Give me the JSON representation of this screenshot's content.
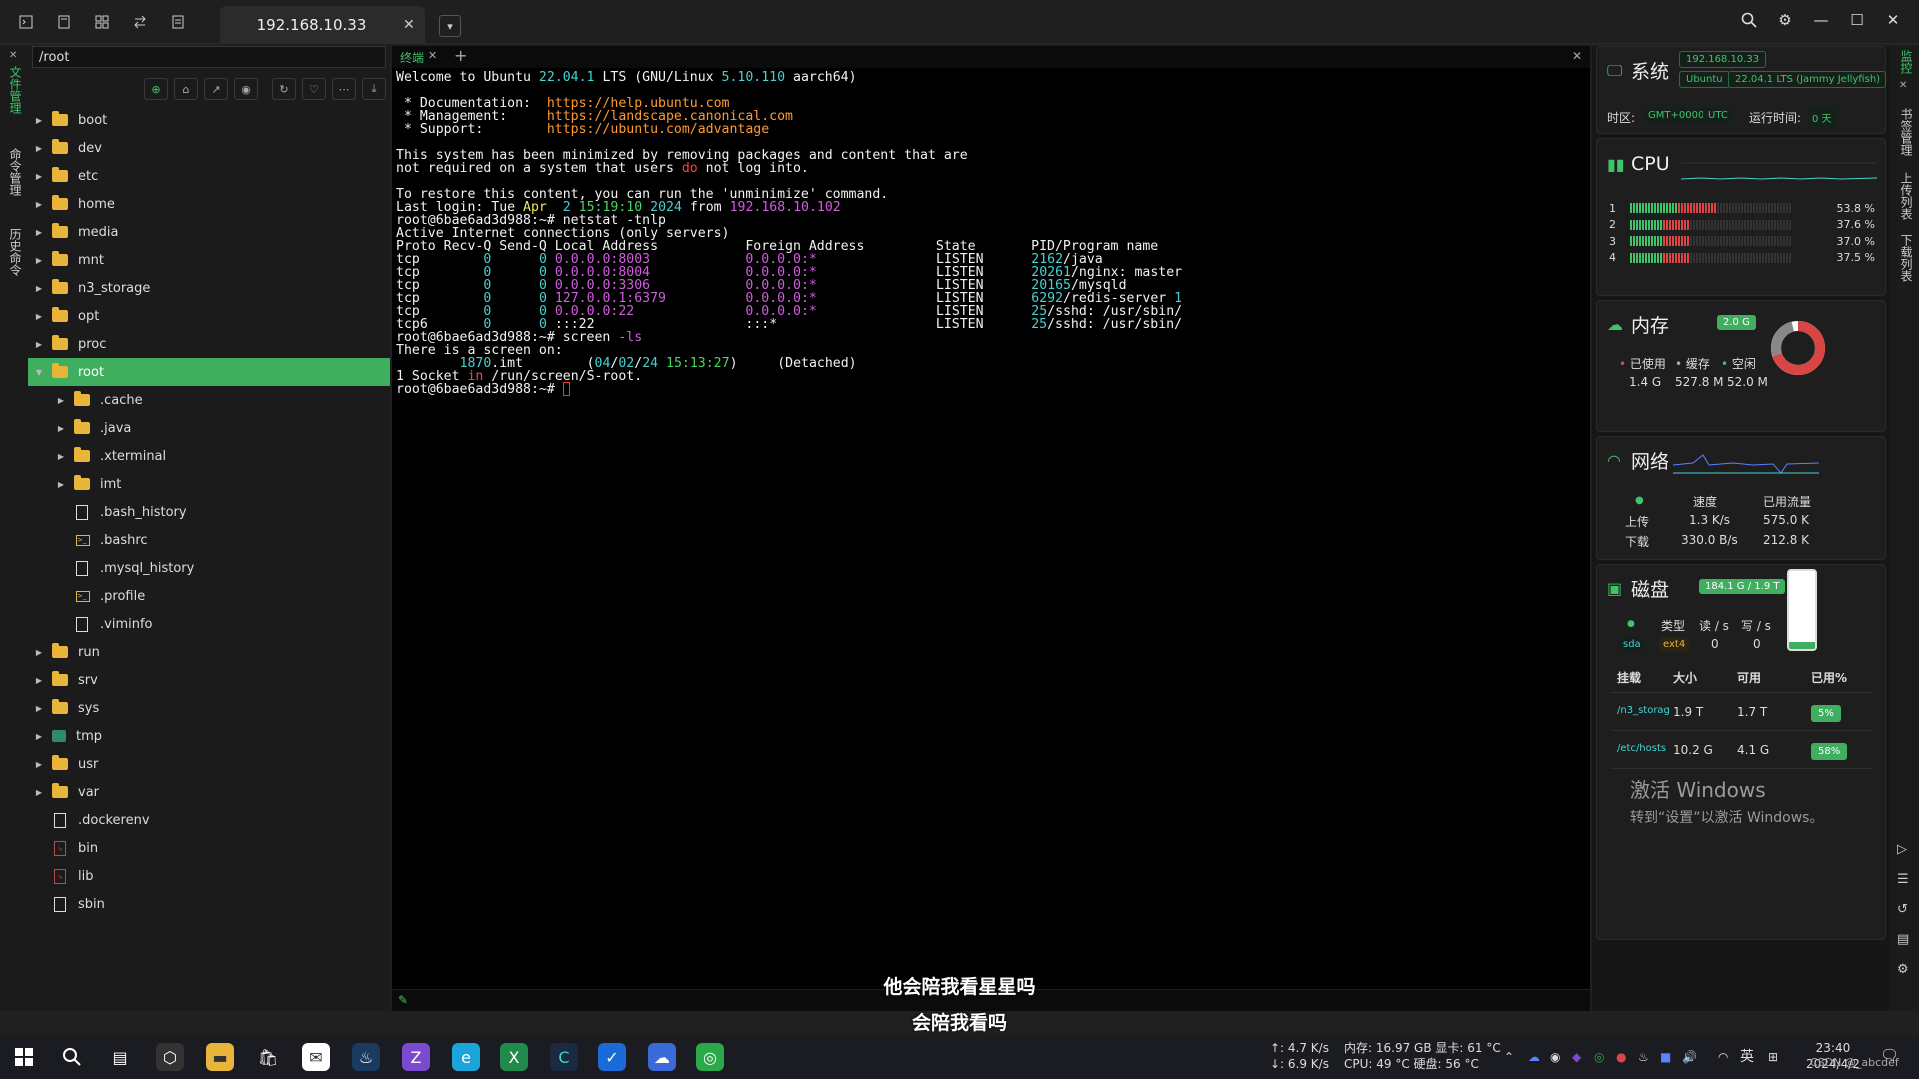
{
  "tab": {
    "title": "192.168.10.33"
  },
  "explorer": {
    "path": "/root",
    "tree": [
      {
        "name": "boot",
        "type": "folder",
        "level": 0
      },
      {
        "name": "dev",
        "type": "folder",
        "level": 0
      },
      {
        "name": "etc",
        "type": "folder",
        "level": 0
      },
      {
        "name": "home",
        "type": "folder",
        "level": 0
      },
      {
        "name": "media",
        "type": "folder",
        "level": 0
      },
      {
        "name": "mnt",
        "type": "folder",
        "level": 0
      },
      {
        "name": "n3_storage",
        "type": "folder",
        "level": 0
      },
      {
        "name": "opt",
        "type": "folder",
        "level": 0
      },
      {
        "name": "proc",
        "type": "folder",
        "level": 0
      },
      {
        "name": "root",
        "type": "folder",
        "level": 0,
        "selected": true,
        "expanded": true
      },
      {
        "name": ".cache",
        "type": "folder",
        "level": 1
      },
      {
        "name": ".java",
        "type": "folder",
        "level": 1
      },
      {
        "name": ".xterminal",
        "type": "folder",
        "level": 1
      },
      {
        "name": "imt",
        "type": "folder",
        "level": 1
      },
      {
        "name": ".bash_history",
        "type": "file",
        "level": 1
      },
      {
        "name": ".bashrc",
        "type": "script",
        "level": 1
      },
      {
        "name": ".mysql_history",
        "type": "file",
        "level": 1
      },
      {
        "name": ".profile",
        "type": "script",
        "level": 1
      },
      {
        "name": ".viminfo",
        "type": "file",
        "level": 1
      },
      {
        "name": "run",
        "type": "folder",
        "level": 0
      },
      {
        "name": "srv",
        "type": "folder",
        "level": 0
      },
      {
        "name": "sys",
        "type": "folder",
        "level": 0
      },
      {
        "name": "tmp",
        "type": "tmp",
        "level": 0
      },
      {
        "name": "usr",
        "type": "folder",
        "level": 0
      },
      {
        "name": "var",
        "type": "folder",
        "level": 0
      },
      {
        "name": ".dockerenv",
        "type": "file",
        "level": 0,
        "leaf": true
      },
      {
        "name": "bin",
        "type": "link",
        "level": 0,
        "leaf": true
      },
      {
        "name": "lib",
        "type": "link",
        "level": 0,
        "leaf": true
      },
      {
        "name": "sbin",
        "type": "file",
        "level": 0,
        "leaf": true
      }
    ]
  },
  "left_strip": [
    "文件管理",
    "命令管理",
    "历史命令"
  ],
  "terminal": {
    "tab_label": "终端",
    "lines": [
      [
        [
          "Welcome to Ubuntu ",
          ""
        ],
        [
          "22.04.1",
          "c-c"
        ],
        [
          " LTS (GNU/Linux ",
          ""
        ],
        [
          "5.10.110",
          "c-c"
        ],
        [
          " aarch64)",
          ""
        ]
      ],
      [
        [
          "",
          ""
        ]
      ],
      [
        [
          " * Documentation:  ",
          ""
        ],
        [
          "https://help.ubuntu.com",
          "c-o"
        ]
      ],
      [
        [
          " * Management:     ",
          ""
        ],
        [
          "https://landscape.canonical.com",
          "c-o"
        ]
      ],
      [
        [
          " * Support:        ",
          ""
        ],
        [
          "https://ubuntu.com/advantage",
          "c-o"
        ]
      ],
      [
        [
          "",
          ""
        ]
      ],
      [
        [
          "This system has been minimized by removing packages and content that are",
          ""
        ]
      ],
      [
        [
          "not required on a system that users ",
          ""
        ],
        [
          "do",
          "c-r"
        ],
        [
          " not log into.",
          ""
        ]
      ],
      [
        [
          "",
          ""
        ]
      ],
      [
        [
          "To restore this content, you can run the 'unminimize' command.",
          ""
        ]
      ],
      [
        [
          "Last login: Tue ",
          ""
        ],
        [
          "Apr",
          "c-y"
        ],
        [
          "  ",
          ""
        ],
        [
          "2",
          "c-c"
        ],
        [
          " ",
          ""
        ],
        [
          "15:19:10",
          "c-g"
        ],
        [
          " ",
          ""
        ],
        [
          "2024",
          "c-c"
        ],
        [
          " from ",
          ""
        ],
        [
          "192.168.10.102",
          "c-m"
        ]
      ],
      [
        [
          "root@6bae6ad3d988:~# netstat -tnlp",
          ""
        ]
      ],
      [
        [
          "Active Internet connections (only servers)",
          ""
        ]
      ],
      [
        [
          "Proto Recv-Q Send-Q Local Address           Foreign Address         State       PID/Program name",
          ""
        ]
      ],
      [
        [
          "tcp        ",
          ""
        ],
        [
          "0",
          "c-c"
        ],
        [
          "      ",
          ""
        ],
        [
          "0",
          "c-c"
        ],
        [
          " ",
          ""
        ],
        [
          "0.0.0.0:8003",
          "c-m"
        ],
        [
          "            ",
          ""
        ],
        [
          "0.0.0.0:*",
          "c-m"
        ],
        [
          "               LISTEN      ",
          ""
        ],
        [
          "2162",
          "c-c"
        ],
        [
          "/java",
          ""
        ]
      ],
      [
        [
          "tcp        ",
          ""
        ],
        [
          "0",
          "c-c"
        ],
        [
          "      ",
          ""
        ],
        [
          "0",
          "c-c"
        ],
        [
          " ",
          ""
        ],
        [
          "0.0.0.0:8004",
          "c-m"
        ],
        [
          "            ",
          ""
        ],
        [
          "0.0.0.0:*",
          "c-m"
        ],
        [
          "               LISTEN      ",
          ""
        ],
        [
          "20261",
          "c-c"
        ],
        [
          "/nginx: master",
          ""
        ]
      ],
      [
        [
          "tcp        ",
          ""
        ],
        [
          "0",
          "c-c"
        ],
        [
          "      ",
          ""
        ],
        [
          "0",
          "c-c"
        ],
        [
          " ",
          ""
        ],
        [
          "0.0.0.0:3306",
          "c-m"
        ],
        [
          "            ",
          ""
        ],
        [
          "0.0.0.0:*",
          "c-m"
        ],
        [
          "               LISTEN      ",
          ""
        ],
        [
          "20165",
          "c-c"
        ],
        [
          "/mysqld",
          ""
        ]
      ],
      [
        [
          "tcp        ",
          ""
        ],
        [
          "0",
          "c-c"
        ],
        [
          "      ",
          ""
        ],
        [
          "0",
          "c-c"
        ],
        [
          " ",
          ""
        ],
        [
          "127.0.0.1:6379",
          "c-m"
        ],
        [
          "          ",
          ""
        ],
        [
          "0.0.0.0:*",
          "c-m"
        ],
        [
          "               LISTEN      ",
          ""
        ],
        [
          "6292",
          "c-c"
        ],
        [
          "/redis-server ",
          ""
        ],
        [
          "1",
          "c-c"
        ]
      ],
      [
        [
          "tcp        ",
          ""
        ],
        [
          "0",
          "c-c"
        ],
        [
          "      ",
          ""
        ],
        [
          "0",
          "c-c"
        ],
        [
          " ",
          ""
        ],
        [
          "0.0.0.0:22",
          "c-m"
        ],
        [
          "              ",
          ""
        ],
        [
          "0.0.0.0:*",
          "c-m"
        ],
        [
          "               LISTEN      ",
          ""
        ],
        [
          "25",
          "c-c"
        ],
        [
          "/sshd: /usr/sbin/",
          ""
        ]
      ],
      [
        [
          "tcp6       ",
          ""
        ],
        [
          "0",
          "c-c"
        ],
        [
          "      ",
          ""
        ],
        [
          "0",
          "c-c"
        ],
        [
          " :::22                   :::*                    LISTEN      ",
          ""
        ],
        [
          "25",
          "c-c"
        ],
        [
          "/sshd: /usr/sbin/",
          ""
        ]
      ],
      [
        [
          "root@6bae6ad3d988:~# screen ",
          ""
        ],
        [
          "-ls",
          "c-m"
        ]
      ],
      [
        [
          "There is a screen on:",
          ""
        ]
      ],
      [
        [
          "        ",
          ""
        ],
        [
          "1870",
          "c-c"
        ],
        [
          ".imt        (",
          ""
        ],
        [
          "04",
          "c-c"
        ],
        [
          "/",
          ""
        ],
        [
          "02",
          "c-c"
        ],
        [
          "/",
          ""
        ],
        [
          "24",
          "c-c"
        ],
        [
          " ",
          ""
        ],
        [
          "15:13:27",
          "c-g"
        ],
        [
          ")     (Detached)",
          ""
        ]
      ],
      [
        [
          "1 Socket ",
          ""
        ],
        [
          "in",
          "c-r"
        ],
        [
          " /run/screen/S-root.",
          ""
        ]
      ],
      [
        [
          "root@6bae6ad3d988:~# ",
          ""
        ]
      ]
    ]
  },
  "sysinfo": {
    "system": {
      "title": "系统",
      "ip": "192.168.10.33",
      "os": "Ubuntu",
      "version": "22.04.1 LTS (Jammy Jellyfish)",
      "tz_label": "时区:",
      "tz_value": "GMT+0000",
      "tz_unit": "UTC",
      "uptime_label": "运行时间:",
      "uptime_value": "0 天"
    },
    "cpu": {
      "title": "CPU",
      "cores": [
        {
          "id": "1",
          "pct_text": "53.8 %",
          "pct": 53.8
        },
        {
          "id": "2",
          "pct_text": "37.6 %",
          "pct": 37.6
        },
        {
          "id": "3",
          "pct_text": "37.0 %",
          "pct": 37.0
        },
        {
          "id": "4",
          "pct_text": "37.5 %",
          "pct": 37.5
        }
      ]
    },
    "memory": {
      "title": "内存",
      "total": "2.0 G",
      "used_label": "已使用",
      "cache_label": "缓存",
      "free_label": "空闲",
      "used": "1.4 G",
      "cache": "527.8 M",
      "free": "52.0 M",
      "used_frac": 0.7,
      "cache_frac": 0.26
    },
    "network": {
      "title": "网络",
      "speed_h": "速度",
      "traffic_h": "已用流量",
      "up_label": "上传",
      "down_label": "下载",
      "up_speed": "1.3 K/s",
      "down_speed": "330.0 B/s",
      "up_total": "575.0 K",
      "down_total": "212.8 K"
    },
    "disk": {
      "title": "磁盘",
      "usage": "184.1 G / 1.9 T",
      "fill_frac": 0.09,
      "dev": "sda",
      "type_h": "类型",
      "read_h": "读 / s",
      "write_h": "写 / s",
      "type": "ext4",
      "read": "0",
      "write": "0",
      "mount_h": "挂载",
      "size_h": "大小",
      "avail_h": "可用",
      "used_h": "已用%",
      "mounts": [
        {
          "mount": "/n3_storage",
          "size": "1.9 T",
          "avail": "1.7 T",
          "used": "5%"
        },
        {
          "mount": "/etc/hosts",
          "size": "10.2 G",
          "avail": "4.1 G",
          "used": "58%"
        }
      ]
    }
  },
  "right_strip": [
    "监控",
    "书签管理",
    "上传列表",
    "下载列表"
  ],
  "activate": {
    "line1": "激活 Windows",
    "line2": "转到“设置”以激活 Windows。"
  },
  "subtitles": {
    "line1": "他会陪我看星星吗",
    "line2": "会陪我看吗"
  },
  "taskbar": {
    "net_up": "↑: 4.7 K/s",
    "net_down": "↓: 6.9 K/s",
    "mem": "内存: 16.97 GB",
    "gpu": "显卡: 61 °C",
    "cpu": "CPU: 49 °C",
    "disk": "硬盘: 56 °C",
    "lang": "英",
    "time": "23:40",
    "date": "2024/4/2",
    "watermark": "CSDN @_abcdef"
  }
}
